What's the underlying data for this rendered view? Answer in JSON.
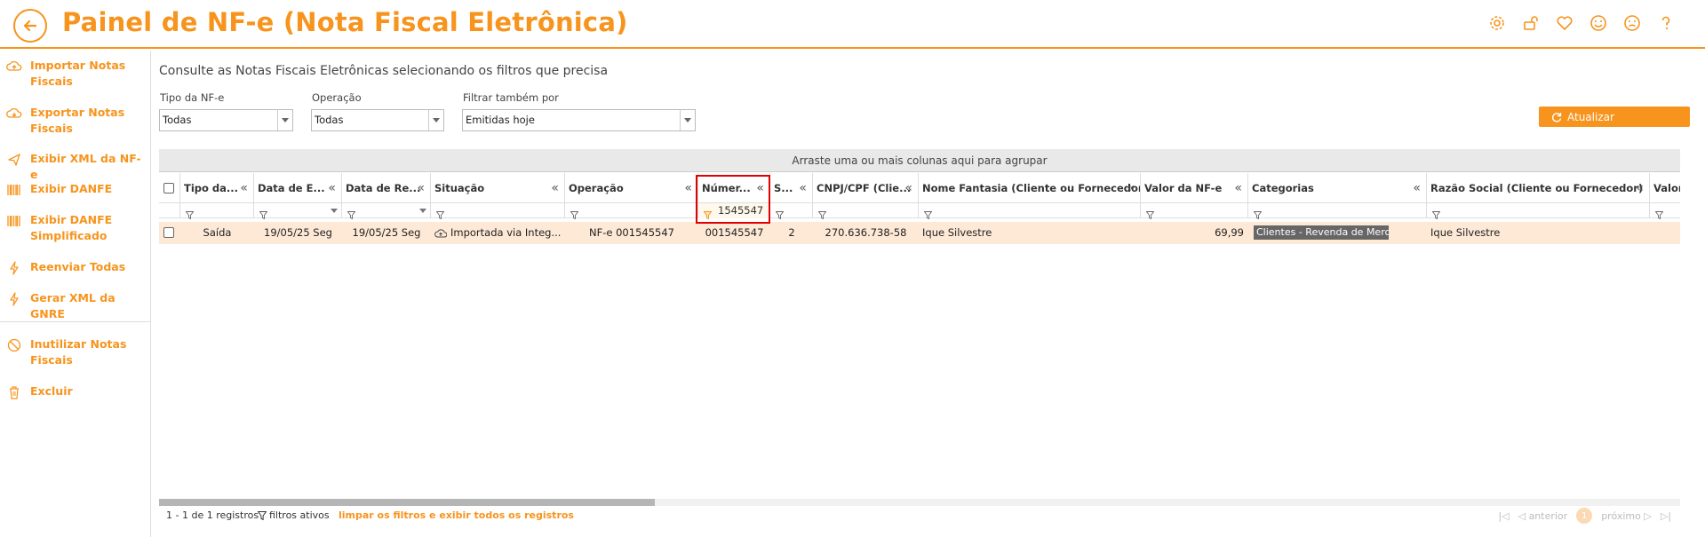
{
  "header": {
    "title": "Painel de NF-e (Nota Fiscal Eletrônica)",
    "icons": [
      "gear-icon",
      "unlock-icon",
      "heart-icon",
      "smile-icon",
      "neutral-face-icon",
      "help-icon"
    ]
  },
  "sidebar": {
    "items": [
      {
        "label": "Importar Notas Fiscais",
        "icon": "cloud-upload-icon"
      },
      {
        "label": "Exportar Notas Fiscais",
        "icon": "cloud-download-icon"
      },
      {
        "label": "Exibir XML da NF-e",
        "icon": "send-icon"
      },
      {
        "label": "Exibir DANFE",
        "icon": "barcode-icon"
      },
      {
        "label": "Exibir DANFE Simplificado",
        "icon": "barcode-icon"
      },
      {
        "label": "Reenviar Todas",
        "icon": "bolt-icon"
      },
      {
        "label": "Gerar XML da GNRE",
        "icon": "bolt-icon"
      },
      {
        "label": "Inutilizar Notas Fiscais",
        "icon": "ban-icon"
      },
      {
        "label": "Excluir",
        "icon": "trash-icon"
      }
    ]
  },
  "main": {
    "subtitle": "Consulte as Notas Fiscais Eletrônicas selecionando os filtros que precisa",
    "filters": {
      "tipo": {
        "label": "Tipo da NF-e",
        "value": "Todas"
      },
      "operacao": {
        "label": "Operação",
        "value": "Todas"
      },
      "filtrar": {
        "label": "Filtrar também por",
        "value": "Emitidas hoje"
      }
    },
    "refresh_label": "Atualizar",
    "group_bar": "Arraste uma ou mais colunas aqui para agrupar"
  },
  "grid": {
    "columns": [
      "Tipo da...",
      "Data de E...",
      "Data de Re...",
      "Situação",
      "Operação",
      "Númer...",
      "S...",
      "CNPJ/CPF (Clie...",
      "Nome Fantasia (Cliente ou Fornecedor)",
      "Valor da NF-e",
      "Categorias",
      "Razão Social (Cliente ou Fornecedor)",
      "Valor"
    ],
    "filter_numero": "1545547",
    "row": {
      "tipo": "Saída",
      "data_emissao": "19/05/25 Seg",
      "data_registro": "19/05/25 Seg",
      "situacao": "Importada via Integ...",
      "operacao": "NF-e 001545547",
      "numero": "001545547",
      "serie": "2",
      "cnpj": "270.636.738-58",
      "nome_fantasia": "Ique Silvestre",
      "valor": "69,99",
      "categoria": "Clientes - Revenda de Mercado...",
      "razao_social": "Ique Silvestre"
    }
  },
  "footer": {
    "count": "1 - 1 de 1 registros",
    "filters_active": "filtros ativos",
    "clear_filters": "limpar os filtros e exibir todos os registros",
    "pager": {
      "prev": "anterior",
      "page": "1",
      "next": "próximo"
    }
  },
  "colors": {
    "accent": "#f7941d",
    "row_highlight": "#fde9d6",
    "callout": "#e00000"
  }
}
